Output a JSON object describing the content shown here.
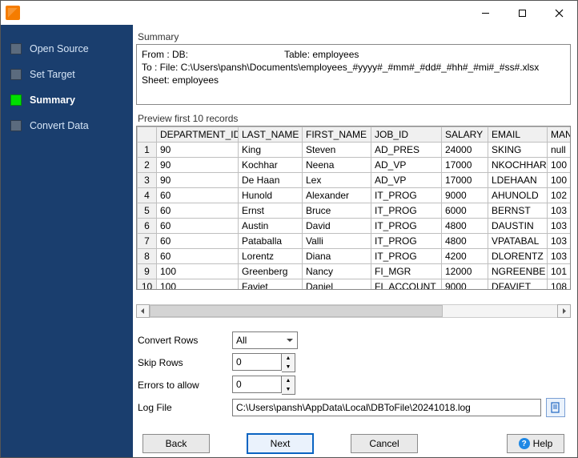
{
  "sidebar": {
    "steps": [
      {
        "label": "Open Source",
        "active": false
      },
      {
        "label": "Set Target",
        "active": false
      },
      {
        "label": "Summary",
        "active": true
      },
      {
        "label": "Convert Data",
        "active": false
      }
    ]
  },
  "summary": {
    "title": "Summary",
    "line1": "From : DB:",
    "table_label": "Table: employees",
    "line2": "To : File: C:\\Users\\pansh\\Documents\\employees_#yyyy#_#mm#_#dd#_#hh#_#mi#_#ss#.xlsx Sheet: employees"
  },
  "preview": {
    "title": "Preview first 10 records",
    "columns": [
      "DEPARTMENT_ID",
      "LAST_NAME",
      "FIRST_NAME",
      "JOB_ID",
      "SALARY",
      "EMAIL",
      "MANAG"
    ],
    "rows": [
      [
        "90",
        "King",
        "Steven",
        "AD_PRES",
        "24000",
        "SKING",
        "null"
      ],
      [
        "90",
        "Kochhar",
        "Neena",
        "AD_VP",
        "17000",
        "NKOCHHAR",
        "100"
      ],
      [
        "90",
        "De Haan",
        "Lex",
        "AD_VP",
        "17000",
        "LDEHAAN",
        "100"
      ],
      [
        "60",
        "Hunold",
        "Alexander",
        "IT_PROG",
        "9000",
        "AHUNOLD",
        "102"
      ],
      [
        "60",
        "Ernst",
        "Bruce",
        "IT_PROG",
        "6000",
        "BERNST",
        "103"
      ],
      [
        "60",
        "Austin",
        "David",
        "IT_PROG",
        "4800",
        "DAUSTIN",
        "103"
      ],
      [
        "60",
        "Pataballa",
        "Valli",
        "IT_PROG",
        "4800",
        "VPATABAL",
        "103"
      ],
      [
        "60",
        "Lorentz",
        "Diana",
        "IT_PROG",
        "4200",
        "DLORENTZ",
        "103"
      ],
      [
        "100",
        "Greenberg",
        "Nancy",
        "FI_MGR",
        "12000",
        "NGREENBE",
        "101"
      ],
      [
        "100",
        "Faviet",
        "Daniel",
        "FI_ACCOUNT",
        "9000",
        "DFAVIET",
        "108"
      ]
    ]
  },
  "form": {
    "convert_rows_label": "Convert Rows",
    "convert_rows_value": "All",
    "skip_rows_label": "Skip Rows",
    "skip_rows_value": "0",
    "errors_label": "Errors to allow",
    "errors_value": "0",
    "logfile_label": "Log File",
    "logfile_value": "C:\\Users\\pansh\\AppData\\Local\\DBToFile\\20241018.log"
  },
  "buttons": {
    "back": "Back",
    "next": "Next",
    "cancel": "Cancel",
    "help": "Help"
  }
}
